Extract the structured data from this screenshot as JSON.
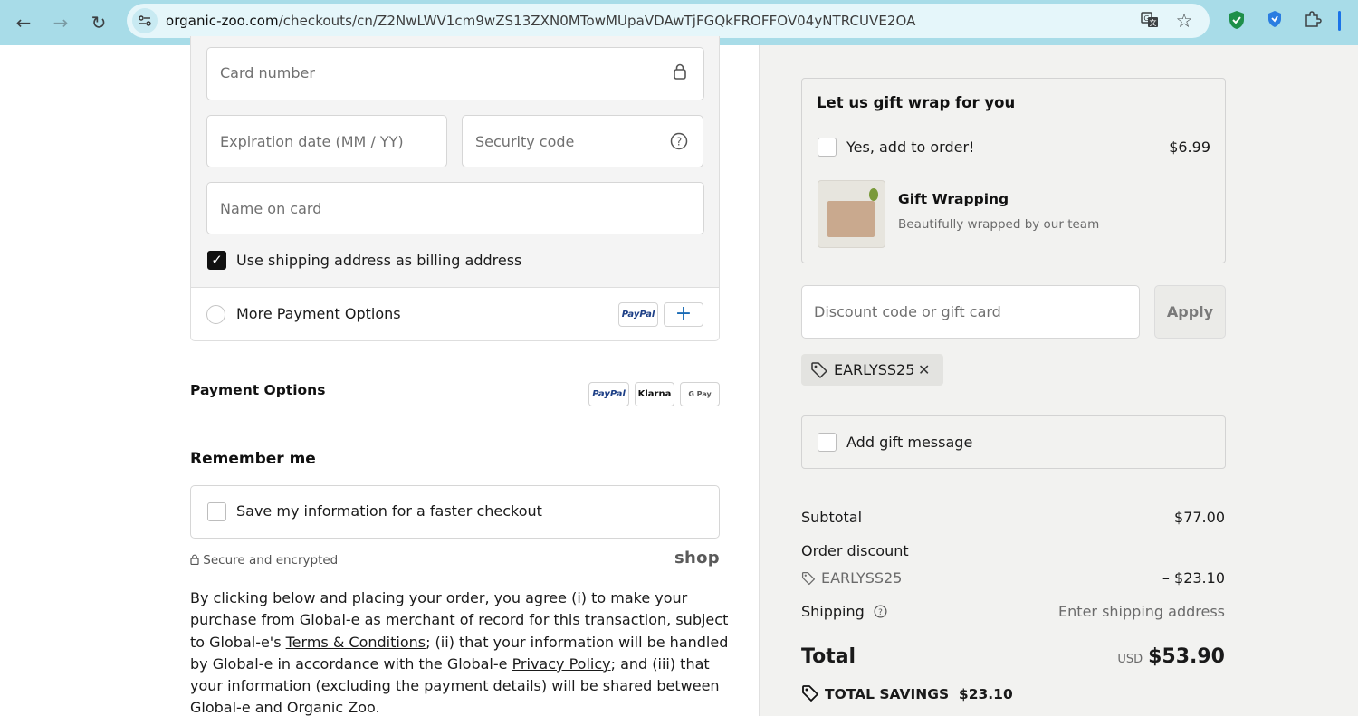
{
  "browser": {
    "url_host": "organic-zoo.com",
    "url_path": "/checkouts/cn/Z2NwLWV1cm9wZS13ZXN0MTowMUpaVDAwTjFGQkFROFFOV04yNTRCUVE2OA",
    "icons": [
      "back-icon",
      "forward-icon",
      "reload-icon",
      "site-settings-icon",
      "translate-icon",
      "star-icon",
      "shield-extension-icon",
      "brave-extension-icon",
      "puzzle-extension-icon"
    ],
    "back_glyph": "←",
    "forward_glyph": "→",
    "reload_glyph": "↻",
    "star_glyph": "☆"
  },
  "payment": {
    "card_number_placeholder": "Card number",
    "expiration_placeholder": "Expiration date (MM / YY)",
    "security_code_placeholder": "Security code",
    "name_on_card_placeholder": "Name on card",
    "billing_same_label": "Use shipping address as billing address",
    "billing_same_checked": true,
    "more_options_label": "More Payment Options",
    "paypal_badge": "PayPal",
    "plus_glyph": "+"
  },
  "payment_options": {
    "title": "Payment Options",
    "badges": [
      "PayPal",
      "Klarna",
      "G Pay"
    ]
  },
  "remember_me": {
    "title": "Remember me",
    "save_label": "Save my information for a faster checkout",
    "secure_text": "Secure and encrypted",
    "shop_logo": "shop"
  },
  "legal": {
    "part1": "By clicking below and placing your order, you agree (i) to make your purchase from Global-e as merchant of record for this transaction, subject to Global-e's ",
    "terms_link": "Terms & Conditions",
    "part2": "; (ii) that your information will be handled by Global-e in accordance with the Global-e ",
    "privacy_link": "Privacy Policy",
    "part3": "; and (iii) that your information (excluding the payment details) will be shared between Global-e and Organic Zoo."
  },
  "gift_wrap": {
    "title": "Let us gift wrap for you",
    "add_label": "Yes, add to order!",
    "price": "$6.99",
    "product_name": "Gift Wrapping",
    "product_desc": "Beautifully wrapped by our team"
  },
  "discount": {
    "placeholder": "Discount code or gift card",
    "apply_label": "Apply",
    "applied_code": "EARLYSS25",
    "remove_glyph": "✕"
  },
  "gift_message": {
    "label": "Add gift message"
  },
  "summary": {
    "subtotal_label": "Subtotal",
    "subtotal_value": "$77.00",
    "order_discount_label": "Order discount",
    "discount_code": "EARLYSS25",
    "discount_value": "– $23.10",
    "shipping_label": "Shipping",
    "shipping_value": "Enter shipping address",
    "total_label": "Total",
    "currency": "USD",
    "total_value": "$53.90",
    "savings_label": "TOTAL SAVINGS",
    "savings_value": "$23.10"
  }
}
